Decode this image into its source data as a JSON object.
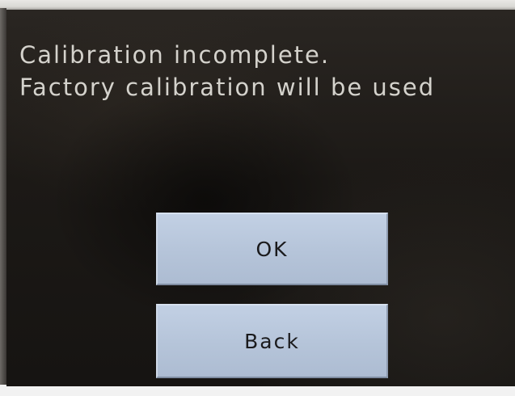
{
  "message": {
    "line1": "Calibration incomplete.",
    "line2": "Factory calibration will be used"
  },
  "buttons": {
    "ok_label": "OK",
    "back_label": "Back"
  },
  "colors": {
    "screen_background": "#1c1916",
    "message_text": "#d4d2cc",
    "button_face": "#b7c6db",
    "button_text": "#1a1a1c"
  }
}
